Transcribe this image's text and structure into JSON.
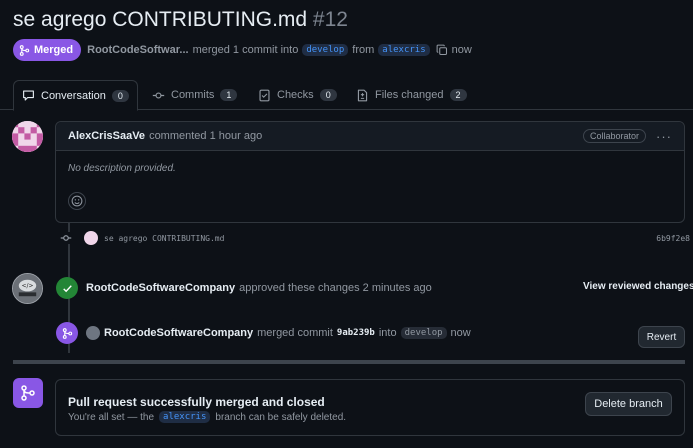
{
  "pr": {
    "title": "se agrego CONTRIBUTING.md",
    "number": "#12",
    "state": "Merged",
    "author": "RootCodeSoftwar...",
    "merged_text": "merged 1 commit into",
    "base_branch": "develop",
    "from_text": "from",
    "head_branch": "alexcris",
    "time": "now"
  },
  "tabs": [
    {
      "label": "Conversation",
      "count": "0",
      "icon": "conversation-icon"
    },
    {
      "label": "Commits",
      "count": "1",
      "icon": "commit-icon"
    },
    {
      "label": "Checks",
      "count": "0",
      "icon": "checks-icon"
    },
    {
      "label": "Files changed",
      "count": "2",
      "icon": "file-diff-icon"
    }
  ],
  "comment": {
    "author": "AlexCrisSaaVe",
    "action": "commented 1 hour ago",
    "badge": "Collaborator",
    "body": "No description provided."
  },
  "commit": {
    "message": "se agrego CONTRIBUTING.md",
    "sha": "6b9f2e8"
  },
  "review": {
    "author": "RootCodeSoftwareCompany",
    "action": "approved these changes 2 minutes ago",
    "view_label": "View reviewed changes"
  },
  "merge_event": {
    "author": "RootCodeSoftwareCompany",
    "action": "merged commit",
    "sha": "9ab239b",
    "into": "into",
    "branch": "develop",
    "time": "now",
    "revert_label": "Revert"
  },
  "merged_box": {
    "title": "Pull request successfully merged and closed",
    "sub_prefix": "You're all set — the",
    "branch": "alexcris",
    "sub_suffix": "branch can be safely deleted.",
    "delete_label": "Delete branch"
  },
  "colors": {
    "merged_purple": "#8957e5",
    "approved_green": "#238636",
    "link_blue": "#4493f8"
  }
}
